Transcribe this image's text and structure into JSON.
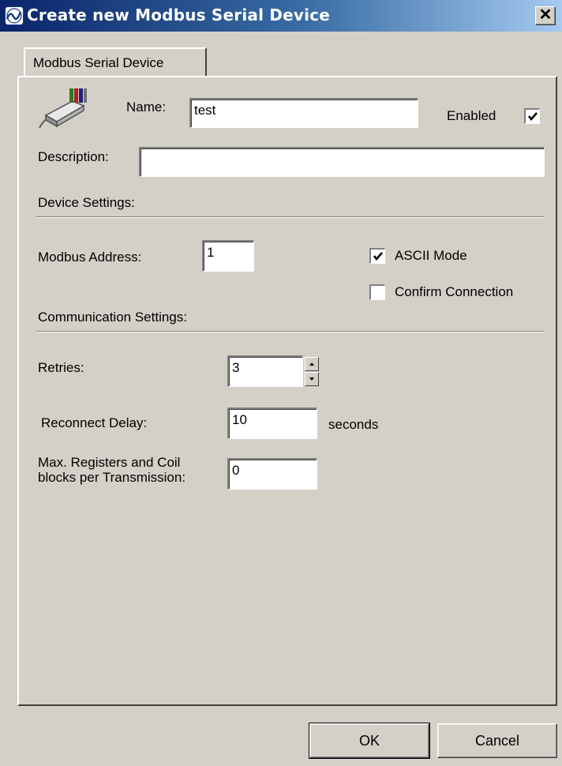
{
  "window": {
    "title": "Create new Modbus Serial Device",
    "close_symbol": "✕",
    "app_icon": "modbus-logo-icon"
  },
  "tab": {
    "label": "Modbus Serial Device"
  },
  "device": {
    "icon": "serial-cable-icon",
    "name_label": "Name:",
    "name_value": "test",
    "enabled_label": "Enabled",
    "enabled_checked": true,
    "description_label": "Description:",
    "description_value": ""
  },
  "device_settings": {
    "heading": "Device Settings:",
    "address_label": "Modbus Address:",
    "address_value": "1",
    "ascii_label": "ASCII Mode",
    "ascii_checked": true,
    "confirm_label": "Confirm Connection",
    "confirm_checked": false
  },
  "communication_settings": {
    "heading": "Communication Settings:",
    "retries_label": "Retries:",
    "retries_value": "3",
    "reconnect_label": "Reconnect Delay:",
    "reconnect_value": "10",
    "reconnect_unit": "seconds",
    "max_label_line1": "Max. Registers and Coil",
    "max_label_line2": "blocks per Transmission:",
    "max_value": "0"
  },
  "buttons": {
    "ok": "OK",
    "cancel": "Cancel"
  },
  "colors": {
    "titlebar_start": "#0a246a",
    "titlebar_end": "#a6caf0",
    "face": "#d4d0c8"
  }
}
